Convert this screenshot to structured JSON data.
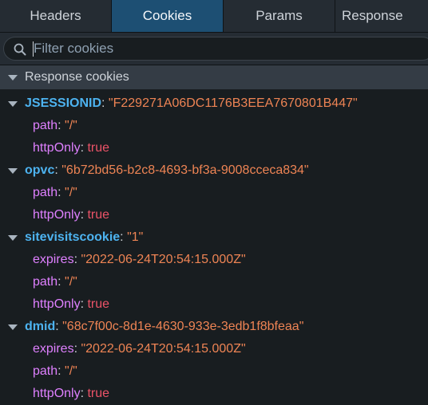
{
  "tabs": [
    {
      "label": "Headers",
      "active": false
    },
    {
      "label": "Cookies",
      "active": true
    },
    {
      "label": "Params",
      "active": false
    },
    {
      "label": "Response",
      "active": false
    }
  ],
  "filter": {
    "placeholder": "Filter cookies",
    "value": ""
  },
  "section": {
    "label": "Response cookies"
  },
  "cookies": [
    {
      "name": "JSESSIONID",
      "value": "\"F229271A06DC1176B3EEA7670801B447\"",
      "props": [
        {
          "key": "path",
          "value": "\"/\"",
          "kind": "string"
        },
        {
          "key": "httpOnly",
          "value": "true",
          "kind": "bool"
        }
      ]
    },
    {
      "name": "opvc",
      "value": "\"6b72bd56-b2c8-4693-bf3a-9008cceca834\"",
      "props": [
        {
          "key": "path",
          "value": "\"/\"",
          "kind": "string"
        },
        {
          "key": "httpOnly",
          "value": "true",
          "kind": "bool"
        }
      ]
    },
    {
      "name": "sitevisitscookie",
      "value": "\"1\"",
      "props": [
        {
          "key": "expires",
          "value": "\"2022-06-24T20:54:15.000Z\"",
          "kind": "string"
        },
        {
          "key": "path",
          "value": "\"/\"",
          "kind": "string"
        },
        {
          "key": "httpOnly",
          "value": "true",
          "kind": "bool"
        }
      ]
    },
    {
      "name": "dmid",
      "value": "\"68c7f00c-8d1e-4630-933e-3edb1f8bfeaa\"",
      "props": [
        {
          "key": "expires",
          "value": "\"2022-06-24T20:54:15.000Z\"",
          "kind": "string"
        },
        {
          "key": "path",
          "value": "\"/\"",
          "kind": "string"
        },
        {
          "key": "httpOnly",
          "value": "true",
          "kind": "bool"
        }
      ]
    }
  ],
  "colors": {
    "active_tab": "#1d4f73",
    "cookie_name": "#4db3f0",
    "property_name": "#df80ff",
    "string_value": "#ee8454",
    "bool_value": "#eb5368"
  },
  "icons": {
    "filter": "search-icon",
    "expand": "triangle-down-icon"
  }
}
